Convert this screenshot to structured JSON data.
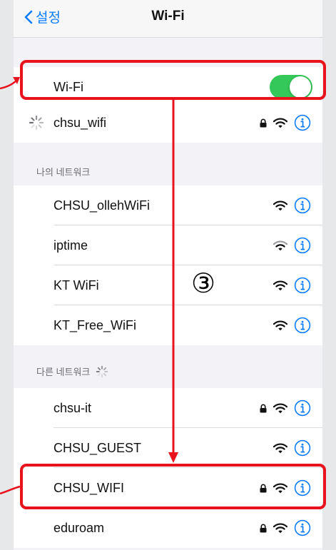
{
  "navbar": {
    "back_label": "설정",
    "title": "Wi-Fi"
  },
  "wifi_toggle": {
    "label": "Wi-Fi",
    "state": "on",
    "on_color": "#34c759"
  },
  "current_network": {
    "name": "chsu_wifi",
    "locked": true,
    "status": "connecting"
  },
  "my_networks": {
    "header": "나의 네트워크",
    "items": [
      {
        "name": "CHSU_ollehWiFi",
        "locked": false
      },
      {
        "name": "iptime",
        "locked": false
      },
      {
        "name": "KT WiFi",
        "locked": false
      },
      {
        "name": "KT_Free_WiFi",
        "locked": false
      }
    ]
  },
  "other_networks": {
    "header": "다른 네트워크",
    "items": [
      {
        "name": "chsu-it",
        "locked": true
      },
      {
        "name": "CHSU_GUEST",
        "locked": false
      },
      {
        "name": "CHSU_WIFI",
        "locked": true
      },
      {
        "name": "eduroam",
        "locked": true
      }
    ]
  },
  "annotation": {
    "step_label": "③",
    "highlight_color": "#e8131c"
  },
  "colors": {
    "accent": "#0a7cff",
    "background": "#f2f2f7",
    "row": "#ffffff"
  }
}
